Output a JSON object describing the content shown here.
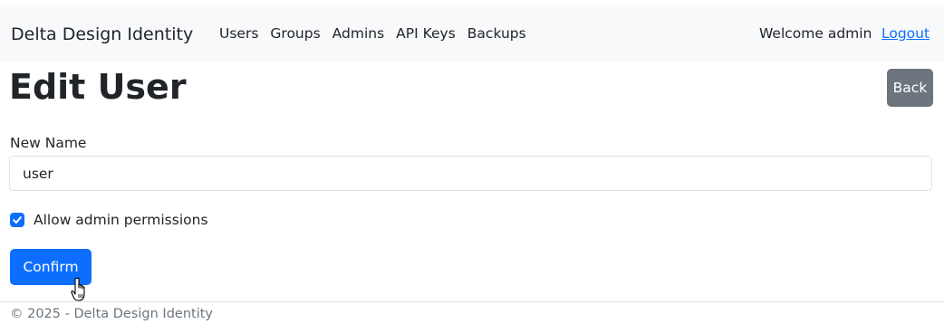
{
  "navbar": {
    "brand": "Delta Design Identity",
    "links": [
      "Users",
      "Groups",
      "Admins",
      "API Keys",
      "Backups"
    ],
    "welcome": "Welcome admin",
    "logout": "Logout"
  },
  "page": {
    "title": "Edit User",
    "back_label": "Back"
  },
  "form": {
    "name_label": "New Name",
    "name_value": "user",
    "admin_checkbox_label": "Allow admin permissions",
    "admin_checked": true,
    "confirm_label": "Confirm"
  },
  "footer": {
    "text": "© 2025 - Delta Design Identity"
  },
  "colors": {
    "primary": "#0d6efd",
    "secondary": "#6c757d",
    "navbar_bg": "#f8f9fa"
  },
  "icons": {
    "checkbox": "check-icon",
    "cursor": "hand-pointer-icon"
  }
}
